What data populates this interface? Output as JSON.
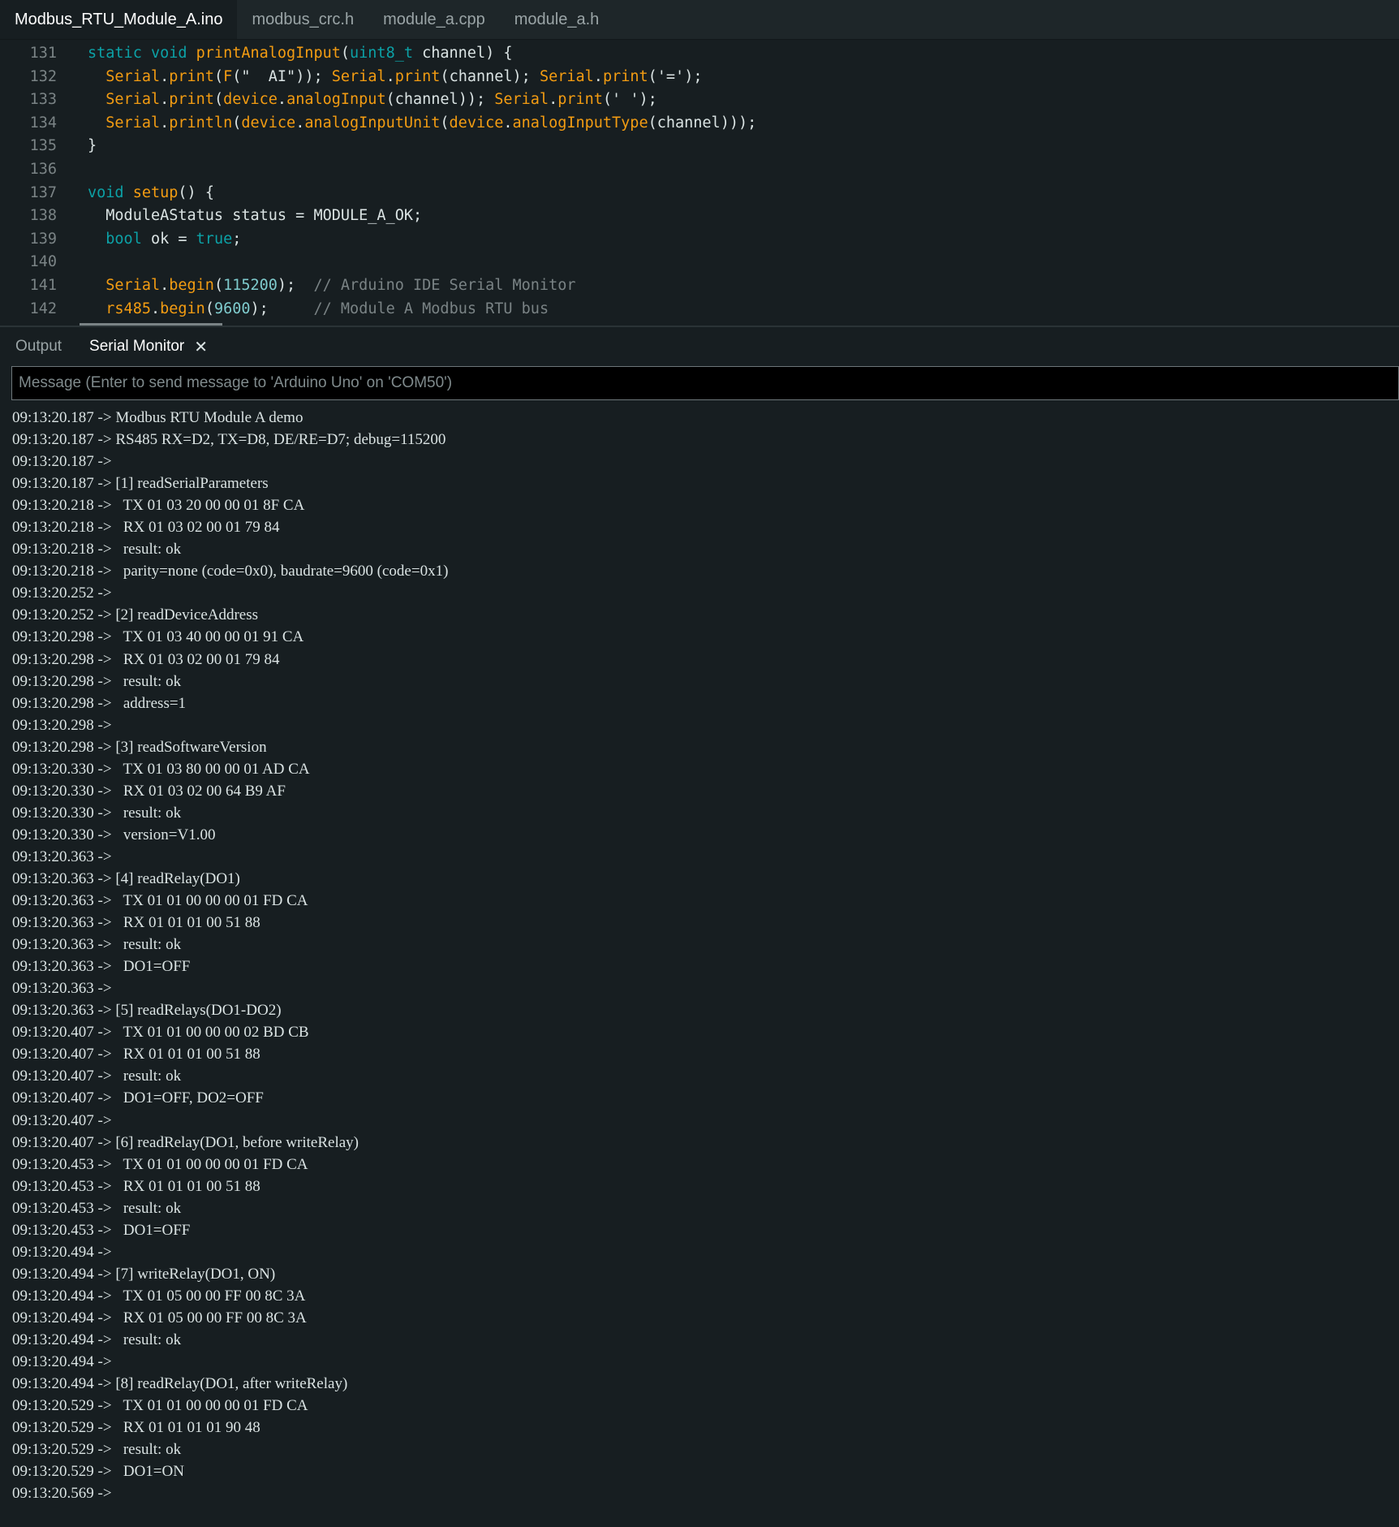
{
  "tabs": [
    "Modbus_RTU_Module_A.ino",
    "modbus_crc.h",
    "module_a.cpp",
    "module_a.h"
  ],
  "code_lines": [
    {
      "num": "131",
      "tokens": [
        [
          "k",
          "static void "
        ],
        [
          "f",
          "printAnalogInput"
        ],
        [
          "d",
          "("
        ],
        [
          "k",
          "uint8_t"
        ],
        [
          "d",
          " channel) {"
        ]
      ]
    },
    {
      "num": "132",
      "tokens": [
        [
          "d",
          "  "
        ],
        [
          "f",
          "Serial"
        ],
        [
          "d",
          "."
        ],
        [
          "f",
          "print"
        ],
        [
          "d",
          "("
        ],
        [
          "f",
          "F"
        ],
        [
          "d",
          "(\"  AI\")); "
        ],
        [
          "f",
          "Serial"
        ],
        [
          "d",
          "."
        ],
        [
          "f",
          "print"
        ],
        [
          "d",
          "(channel); "
        ],
        [
          "f",
          "Serial"
        ],
        [
          "d",
          "."
        ],
        [
          "f",
          "print"
        ],
        [
          "d",
          "('=');"
        ]
      ]
    },
    {
      "num": "133",
      "tokens": [
        [
          "d",
          "  "
        ],
        [
          "f",
          "Serial"
        ],
        [
          "d",
          "."
        ],
        [
          "f",
          "print"
        ],
        [
          "d",
          "("
        ],
        [
          "f",
          "device"
        ],
        [
          "d",
          "."
        ],
        [
          "f",
          "analogInput"
        ],
        [
          "d",
          "(channel)); "
        ],
        [
          "f",
          "Serial"
        ],
        [
          "d",
          "."
        ],
        [
          "f",
          "print"
        ],
        [
          "d",
          "(' ');"
        ]
      ]
    },
    {
      "num": "134",
      "tokens": [
        [
          "d",
          "  "
        ],
        [
          "f",
          "Serial"
        ],
        [
          "d",
          "."
        ],
        [
          "f",
          "println"
        ],
        [
          "d",
          "("
        ],
        [
          "f",
          "device"
        ],
        [
          "d",
          "."
        ],
        [
          "f",
          "analogInputUnit"
        ],
        [
          "d",
          "("
        ],
        [
          "f",
          "device"
        ],
        [
          "d",
          "."
        ],
        [
          "f",
          "analogInputType"
        ],
        [
          "d",
          "(channel)));"
        ]
      ]
    },
    {
      "num": "135",
      "tokens": [
        [
          "d",
          "}"
        ]
      ]
    },
    {
      "num": "136",
      "tokens": []
    },
    {
      "num": "137",
      "tokens": [
        [
          "k",
          "void "
        ],
        [
          "f",
          "setup"
        ],
        [
          "d",
          "() {"
        ]
      ]
    },
    {
      "num": "138",
      "tokens": [
        [
          "d",
          "  ModuleAStatus status = MODULE_A_OK;"
        ]
      ]
    },
    {
      "num": "139",
      "tokens": [
        [
          "d",
          "  "
        ],
        [
          "k",
          "bool"
        ],
        [
          "d",
          " ok = "
        ],
        [
          "k",
          "true"
        ],
        [
          "d",
          ";"
        ]
      ]
    },
    {
      "num": "140",
      "tokens": []
    },
    {
      "num": "141",
      "tokens": [
        [
          "d",
          "  "
        ],
        [
          "f",
          "Serial"
        ],
        [
          "d",
          "."
        ],
        [
          "f",
          "begin"
        ],
        [
          "d",
          "("
        ],
        [
          "n",
          "115200"
        ],
        [
          "d",
          ");  "
        ],
        [
          "c",
          "// Arduino IDE Serial Monitor"
        ]
      ]
    },
    {
      "num": "142",
      "tokens": [
        [
          "d",
          "  "
        ],
        [
          "f",
          "rs485"
        ],
        [
          "d",
          "."
        ],
        [
          "f",
          "begin"
        ],
        [
          "d",
          "("
        ],
        [
          "n",
          "9600"
        ],
        [
          "d",
          ");     "
        ],
        [
          "c",
          "// Module A Modbus RTU bus"
        ]
      ]
    }
  ],
  "panel": {
    "output_tab": "Output",
    "serial_tab": "Serial Monitor",
    "placeholder": "Message (Enter to send message to 'Arduino Uno' on 'COM50')"
  },
  "serial_lines": [
    "09:13:20.187 -> Modbus RTU Module A demo",
    "09:13:20.187 -> RS485 RX=D2, TX=D8, DE/RE=D7; debug=115200",
    "09:13:20.187 -> ",
    "09:13:20.187 -> [1] readSerialParameters",
    "09:13:20.218 ->   TX 01 03 20 00 00 01 8F CA",
    "09:13:20.218 ->   RX 01 03 02 00 01 79 84",
    "09:13:20.218 ->   result: ok",
    "09:13:20.218 ->   parity=none (code=0x0), baudrate=9600 (code=0x1)",
    "09:13:20.252 -> ",
    "09:13:20.252 -> [2] readDeviceAddress",
    "09:13:20.298 ->   TX 01 03 40 00 00 01 91 CA",
    "09:13:20.298 ->   RX 01 03 02 00 01 79 84",
    "09:13:20.298 ->   result: ok",
    "09:13:20.298 ->   address=1",
    "09:13:20.298 -> ",
    "09:13:20.298 -> [3] readSoftwareVersion",
    "09:13:20.330 ->   TX 01 03 80 00 00 01 AD CA",
    "09:13:20.330 ->   RX 01 03 02 00 64 B9 AF",
    "09:13:20.330 ->   result: ok",
    "09:13:20.330 ->   version=V1.00",
    "09:13:20.363 -> ",
    "09:13:20.363 -> [4] readRelay(DO1)",
    "09:13:20.363 ->   TX 01 01 00 00 00 01 FD CA",
    "09:13:20.363 ->   RX 01 01 01 00 51 88",
    "09:13:20.363 ->   result: ok",
    "09:13:20.363 ->   DO1=OFF",
    "09:13:20.363 -> ",
    "09:13:20.363 -> [5] readRelays(DO1-DO2)",
    "09:13:20.407 ->   TX 01 01 00 00 00 02 BD CB",
    "09:13:20.407 ->   RX 01 01 01 00 51 88",
    "09:13:20.407 ->   result: ok",
    "09:13:20.407 ->   DO1=OFF, DO2=OFF",
    "09:13:20.407 -> ",
    "09:13:20.407 -> [6] readRelay(DO1, before writeRelay)",
    "09:13:20.453 ->   TX 01 01 00 00 00 01 FD CA",
    "09:13:20.453 ->   RX 01 01 01 00 51 88",
    "09:13:20.453 ->   result: ok",
    "09:13:20.453 ->   DO1=OFF",
    "09:13:20.494 -> ",
    "09:13:20.494 -> [7] writeRelay(DO1, ON)",
    "09:13:20.494 ->   TX 01 05 00 00 FF 00 8C 3A",
    "09:13:20.494 ->   RX 01 05 00 00 FF 00 8C 3A",
    "09:13:20.494 ->   result: ok",
    "09:13:20.494 -> ",
    "09:13:20.494 -> [8] readRelay(DO1, after writeRelay)",
    "09:13:20.529 ->   TX 01 01 00 00 00 01 FD CA",
    "09:13:20.529 ->   RX 01 01 01 01 90 48",
    "09:13:20.529 ->   result: ok",
    "09:13:20.529 ->   DO1=ON",
    "09:13:20.569 -> "
  ]
}
